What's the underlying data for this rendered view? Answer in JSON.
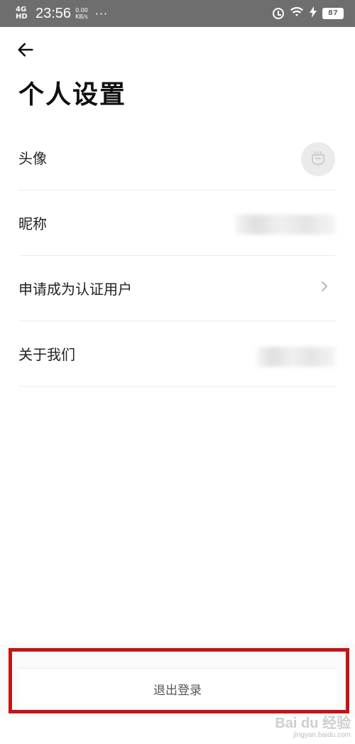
{
  "status_bar": {
    "network": "4G HD",
    "time": "23:56",
    "speed_value": "0.00",
    "speed_unit": "KB/s",
    "more": "···",
    "battery": "87"
  },
  "header": {
    "back_icon": "arrow-left-icon",
    "title": "个人设置"
  },
  "settings": {
    "items": [
      {
        "label": "头像",
        "accessory": "avatar"
      },
      {
        "label": "昵称",
        "accessory": "blurred-value"
      },
      {
        "label": "申请成为认证用户",
        "accessory": "chevron-right-icon"
      },
      {
        "label": "关于我们",
        "accessory": "blurred-value"
      }
    ]
  },
  "footer": {
    "logout_label": "退出登录",
    "highlight_color": "#c41417"
  },
  "watermark": {
    "logo": "Bai du 经验",
    "url": "jingyan.baidu.com"
  }
}
